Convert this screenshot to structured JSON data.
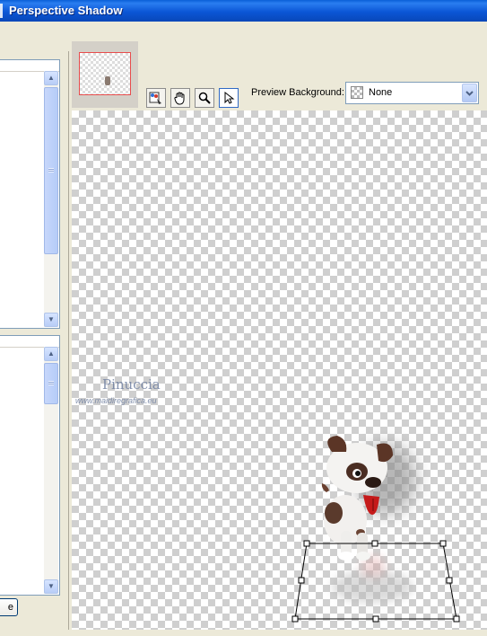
{
  "window": {
    "title": "Perspective Shadow"
  },
  "left_panel": {
    "button_label": "e"
  },
  "toolbar": {
    "tools": [
      {
        "name": "navigate-tool",
        "icon": "palette-icon"
      },
      {
        "name": "pan-tool",
        "icon": "hand-icon"
      },
      {
        "name": "zoom-tool",
        "icon": "magnifier-icon"
      },
      {
        "name": "pointer-tool",
        "icon": "arrow-pointer-icon",
        "active": true
      }
    ],
    "preview_background_label": "Preview Background:",
    "preview_background_value": "None"
  },
  "preview": {
    "watermark_name": "Pinuccia",
    "watermark_url": "www.maidiregrafica.eu"
  },
  "colors": {
    "titlebar": "#0a5fd8",
    "handle": "#000000",
    "navigator_frame": "#e84d4d"
  }
}
